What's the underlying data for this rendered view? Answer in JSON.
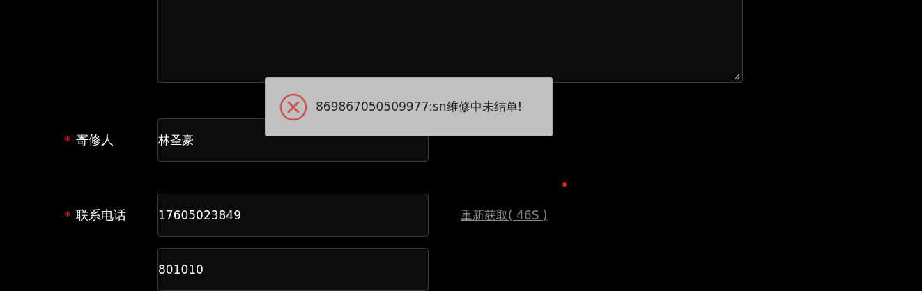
{
  "fields": [
    {
      "required_mark": "*",
      "label": "寄修人",
      "value": "林圣豪"
    },
    {
      "required_mark": "*",
      "label": "联系电话",
      "value": "17605023849",
      "action_link": "重新获取( 46S )"
    },
    {
      "value": "801010"
    }
  ],
  "toast": {
    "kind": "error",
    "message": "869867050509977:sn维修中未结单!"
  }
}
